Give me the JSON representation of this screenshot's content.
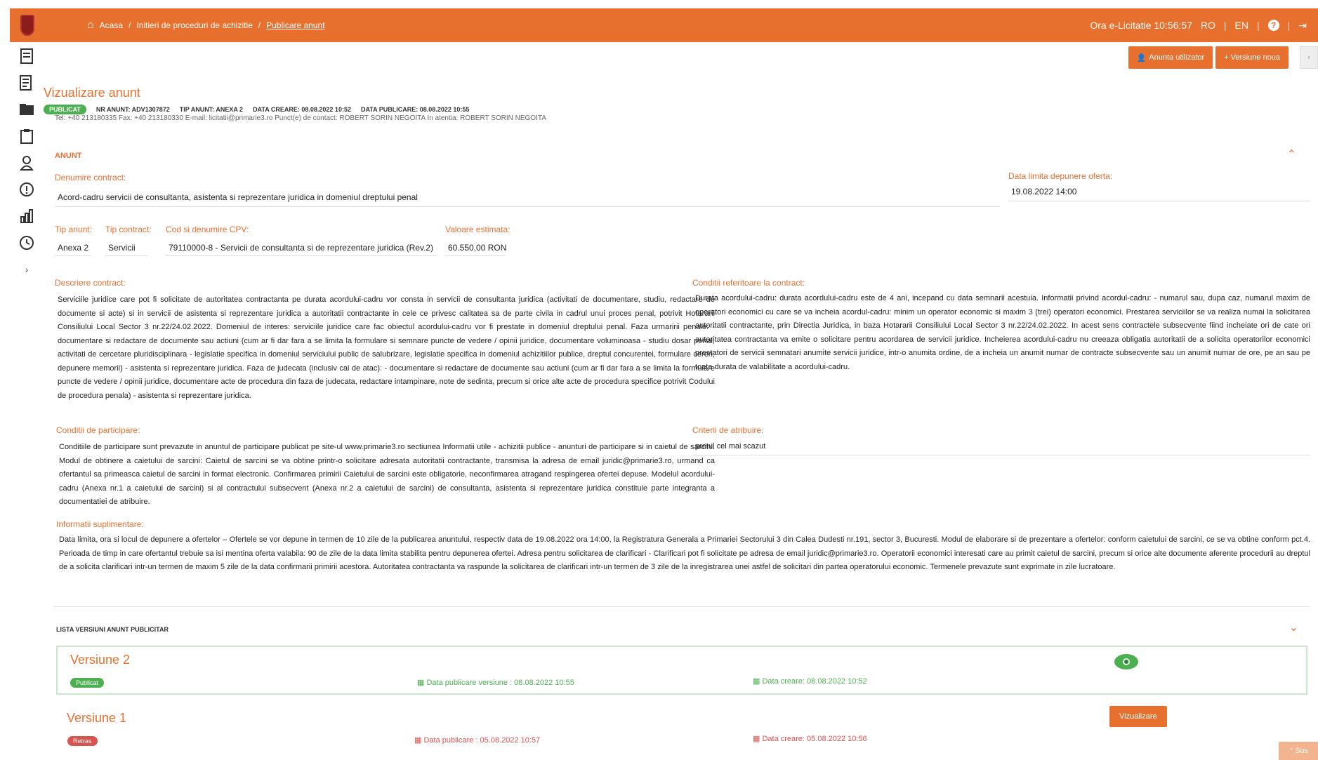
{
  "topbar": {
    "breadcrumbs": [
      "Acasa",
      "Initieri de proceduri de achizitie",
      "Publicare anunt"
    ],
    "time_label": "Ora e-Licitatie",
    "time_value": "10:56:57",
    "lang_ro": "RO",
    "lang_en": "EN"
  },
  "toolbar": {
    "notify_label": "Anunta utilizator",
    "new_version_label": "+ Versiune noua"
  },
  "header": {
    "title": "Vizualizare anunt",
    "status": "PUBLICAT",
    "nr_anunt": "NR ANUNT: ADV1307872",
    "tip_anunt": "TIP ANUNT: ANEXA 2",
    "data_creare": "DATA CREARE: 08.08.2022 10:52",
    "data_publicare": "DATA PUBLICARE: 08.08.2022 10:55",
    "cut_line": "Tel: +40 213180335   Fax: +40 213180330   E-mail: licitatii@primarie3.ro   Punct(e) de contact: ROBERT SORIN NEGOITA   In atentia: ROBERT SORIN NEGOITA"
  },
  "anunt": {
    "section_title": "ANUNT",
    "denumire_label": "Denumire contract:",
    "denumire_value": "Acord-cadru servicii de consultanta, asistenta si reprezentare juridica in domeniul dreptului penal",
    "termen_label": "Data limita depunere oferta:",
    "termen_value": "19.08.2022 14:00",
    "tip_anunt_label": "Tip anunt:",
    "tip_anunt_value": "Anexa 2",
    "tip_contract_label": "Tip contract:",
    "tip_contract_value": "Servicii",
    "cpv_label": "Cod si denumire CPV:",
    "cpv_value": "79110000-8 - Servicii de consultanta si de reprezentare juridica (Rev.2)",
    "valoare_label": "Valoare estimata:",
    "valoare_value": "60.550,00 RON",
    "descriere_label": "Descriere contract:",
    "descriere_value": "Serviciile juridice care pot fi solicitate de autoritatea contractanta pe durata acordului-cadru vor consta in servicii de consultanta juridica (activitati de documentare, studiu, redactare de documente si acte) si in servicii de asistenta si reprezentare juridica a autoritatii contractante in cele ce privesc calitatea sa de parte civila in cadrul unui proces penal, potrivit Hotararii Consiliului Local Sector 3 nr.22/24.02.2022. Domeniul de interes: serviciile juridice care fac obiectul acordului-cadru vor fi prestate in domeniul dreptului penal. Faza urmaririi penale: - documentare si redactare de documente sau actiuni (cum ar fi dar fara a se limita la formulare si semnare puncte de vedere / opinii juridice, documentare voluminoasa - studiu dosar penal, activitati de cercetare pluridisciplinara - legislatie specifica in domeniul serviciului public de salubrizare, legislatie specifica in domeniul achizitiilor publice, dreptul concurentei, formulare cereri, depunere memorii) - asistenta si reprezentare juridica. Faza de judecata (inclusiv cai de atac): - documentare si redactare de documente sau actiuni (cum ar fi dar fara a se limita la formulare puncte de vedere / opinii juridice, documentare acte de procedura din faza de judecata, redactare intampinare, note de sedinta, precum si orice alte acte de procedura specifice potrivit Codului de procedura penala) - asistenta si reprezentare juridica.",
    "conditii_contract_label": "Conditii referitoare la contract:",
    "conditii_contract_value": "Durata acordului-cadru: durata acordului-cadru este de 4 ani, incepand cu data semnarii acestuia. Informatii privind acordul-cadru: - numarul sau, dupa caz, numarul maxim de operatori economici cu care se va incheia acordul-cadru: minim un operator economic si maxim 3 (trei) operatori economici. Prestarea serviciilor se va realiza numai la solicitarea autoritatii contractante, prin Directia Juridica, in baza Hotararii Consiliului Local Sector 3 nr.22/24.02.2022. In acest sens contractele subsecvente fiind incheiate ori de cate ori autoritatea contractanta va emite o solicitare pentru acordarea de servicii juridice. Incheierea acordului-cadru nu creeaza obligatia autoritatii de a solicita operatorilor economici prestatori de servicii semnatari anumite servicii juridice, intr-o anumita ordine, de a incheia un anumit numar de contracte subsecvente sau un anumit numar de ore, pe an sau pe toata durata de valabilitate a acordului-cadru.",
    "conditii_participare_label": "Conditii de participare:",
    "conditii_participare_value": "Conditiile de participare sunt prevazute in anuntul de participare publicat pe site-ul www.primarie3.ro sectiunea Informatii utile - achizitii publice - anunturi de participare si in caietul de sarcini. Modul de obtinere a caietului de sarcini: Caietul de sarcini se va obtine printr-o solicitare adresata autoritatii contractante, transmisa la adresa de email juridic@primarie3.ro, urmand ca ofertantul sa primeasca caietul de sarcini in format electronic. Confirmarea primirii Caietului de sarcini este obligatorie, neconfirmarea atragand respingerea ofertei depuse. Modelul acordului-cadru (Anexa nr.1 a caietului de sarcini) si al contractului subsecvent (Anexa nr.2 a caietului de sarcini) de consultanta, asistenta si reprezentare juridica constituie parte integranta a documentatiei de atribuire.",
    "criterii_label": "Criterii de atribuire:",
    "criterii_value": "pretul cel mai scazut",
    "info_label": "Informatii suplimentare:",
    "info_value": "Data limita, ora si locul de depunere a ofertelor – Ofertele se vor depune in termen de 10 zile de la publicarea anuntului, respectiv data de 19.08.2022 ora 14:00, la Registratura Generala a Primariei Sectorului 3 din Calea Dudesti nr.191, sector 3, Bucuresti. Modul de elaborare si de prezentare a ofertelor: conform caietului de sarcini, ce se va obtine conform pct.4. Perioada de timp in care ofertantul trebuie sa isi mentina oferta valabila: 90 de zile de la data limita stabilita pentru depunerea ofertei. Adresa pentru solicitarea de clarificari - Clarificari pot fi solicitate pe adresa de email juridic@primarie3.ro. Operatorii economici interesati care au primit caietul de sarcini, precum si orice alte documente aferente procedurii au dreptul de a solicita clarificari intr-un termen de maxim 5 zile de la data confirmarii primirii acestora. Autoritatea contractanta va raspunde la solicitarea de clarificari intr-un termen de 3 zile de la inregistrarea unei astfel de solicitari din partea operatorului economic. Termenele prevazute sunt exprimate in zile lucratoare."
  },
  "versions": {
    "title": "LISTA VERSIUNI ANUNT PUBLICITAR",
    "items": [
      {
        "name": "Versiune 2",
        "status": "Publicat",
        "publicare": "Data publicare versiune : 08.08.2022 10:55",
        "creare": "Data creare: 08.08.2022 10:52"
      },
      {
        "name": "Versiune 1",
        "status": "Retras",
        "publicare": "Data publicare : 05.08.2022 10:57",
        "creare": "Data creare: 05.08.2022 10:56",
        "action_label": "Vizualizare"
      }
    ],
    "scroll_top_label": "Sus"
  },
  "colors": {
    "brand": "#e8702f",
    "success": "#4caf50",
    "danger": "#d9534f"
  },
  "icons": [
    "home-icon",
    "document-icon",
    "list-icon",
    "folder-icon",
    "clipboard-icon",
    "user-icon",
    "info-icon",
    "chart-icon",
    "history-icon",
    "chevron-right-icon",
    "question-icon",
    "logout-icon",
    "eye-icon",
    "calendar-icon"
  ]
}
